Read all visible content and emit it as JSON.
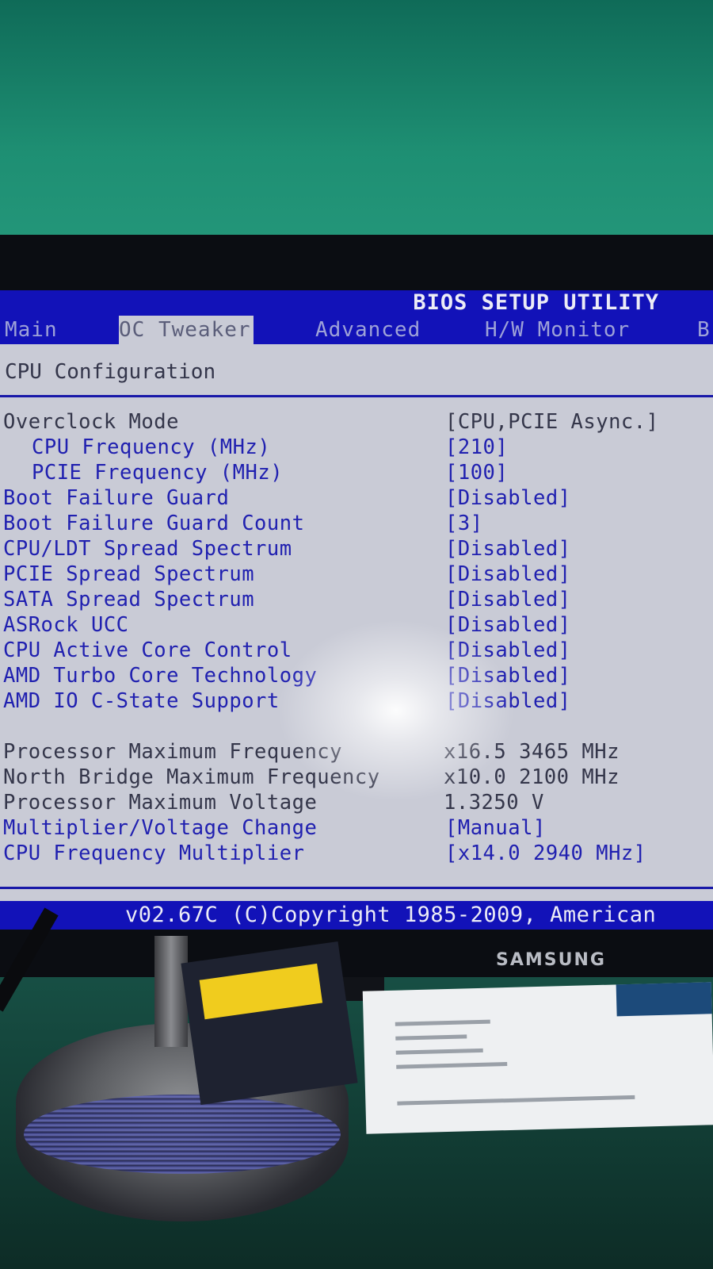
{
  "bios": {
    "title": "BIOS SETUP UTILITY",
    "tabs": [
      {
        "label": "Main",
        "active": false
      },
      {
        "label": "OC Tweaker",
        "active": true
      },
      {
        "label": "Advanced",
        "active": false
      },
      {
        "label": "H/W Monitor",
        "active": false
      },
      {
        "label": "B",
        "active": false
      }
    ],
    "section_title": "CPU Configuration",
    "settings": [
      {
        "label": "Overclock Mode",
        "value": "[CPU,PCIE Async.]"
      },
      {
        "label": "CPU Frequency (MHz)",
        "value": "[210]"
      },
      {
        "label": "PCIE Frequency (MHz)",
        "value": "[100]"
      },
      {
        "label": "Boot Failure Guard",
        "value": "[Disabled]"
      },
      {
        "label": "Boot Failure Guard Count",
        "value": "[3]"
      },
      {
        "label": "CPU/LDT Spread Spectrum",
        "value": "[Disabled]"
      },
      {
        "label": "PCIE Spread Spectrum",
        "value": "[Disabled]"
      },
      {
        "label": "SATA Spread Spectrum",
        "value": "[Disabled]"
      },
      {
        "label": "ASRock UCC",
        "value": "[Disabled]"
      },
      {
        "label": "CPU Active Core Control",
        "value": "[Disabled]"
      },
      {
        "label": "AMD Turbo Core Technology",
        "value": "[Disabled]"
      },
      {
        "label": "AMD IO C-State Support",
        "value": "[Disabled]"
      }
    ],
    "info": [
      {
        "label": "Processor Maximum Frequency",
        "value": "x16.5 3465 MHz"
      },
      {
        "label": "North Bridge Maximum Frequency",
        "value": "x10.0 2100 MHz"
      },
      {
        "label": "Processor Maximum Voltage",
        "value": "1.3250 V"
      }
    ],
    "settings2": [
      {
        "label": "Multiplier/Voltage Change",
        "value": "[Manual]"
      },
      {
        "label": "CPU Frequency Multiplier",
        "value": "[x14.0 2940 MHz]"
      }
    ],
    "footer": "v02.67C (C)Copyright 1985-2009, American"
  },
  "monitor": {
    "brand": "SAMSUNG"
  },
  "colors": {
    "bios_blue": "#1212b8",
    "bios_gray": "#c9cbd6",
    "option_text": "#2020b0"
  }
}
